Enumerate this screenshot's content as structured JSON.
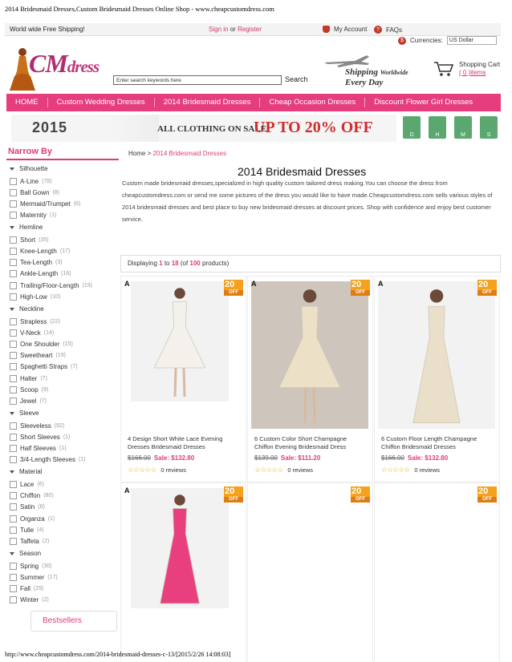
{
  "print_header": "2014 Bridesmaid Dresses,Custom Bridesmaid Dresses Online Shop - www.cheapcustomdress.com",
  "print_footer": "http://www.cheapcustomdress.com/2014-bridesmaid-dresses-c-13/[2015/2/26 14:08:03]",
  "topbar": {
    "free_shipping": "World wide Free Shipping!",
    "sign_in": "Sign in",
    "or": "or",
    "register": "Register",
    "my_account": "My Account",
    "faqs": "FAQs"
  },
  "currency": {
    "label": "Currencies:",
    "selected": "US Dollar"
  },
  "logo": {
    "main": "CM",
    "tail": "dress"
  },
  "search": {
    "placeholder": "Enter search keywords here",
    "button": "Search"
  },
  "shipping_badge": {
    "line1": "Shipping",
    "line1b": "Worldwide",
    "line2": "Every Day"
  },
  "cart": {
    "label": "Shopping Cart",
    "items": "( 0 )items"
  },
  "nav": [
    "HOME",
    "Custom Wedding Dresses",
    "2014 Bridesmaid Dresses",
    "Cheap Occasion Dresses",
    "Discount Flower Girl Dresses"
  ],
  "banner": {
    "year": "2015",
    "sale": "ALL CLOTHING ON SALE",
    "upto": "UP TO 20% OFF",
    "timer": [
      "D",
      "H",
      "M",
      "S"
    ]
  },
  "sidebar": {
    "title": "Narrow By",
    "groups": [
      {
        "name": "Silhouette",
        "options": [
          [
            "A-Line",
            "(78)"
          ],
          [
            "Ball Gown",
            "(8)"
          ],
          [
            "Mermaid/Trumpet",
            "(6)"
          ],
          [
            "Maternity",
            "(1)"
          ]
        ]
      },
      {
        "name": "Hemline",
        "options": [
          [
            "Short",
            "(35)"
          ],
          [
            "Knee-Length",
            "(17)"
          ],
          [
            "Tea-Length",
            "(3)"
          ],
          [
            "Ankle-Length",
            "(16)"
          ],
          [
            "Trailing/Floor-Length",
            "(19)"
          ],
          [
            "High-Low",
            "(10)"
          ]
        ]
      },
      {
        "name": "Neckline",
        "options": [
          [
            "Strapless",
            "(22)"
          ],
          [
            "V-Neck",
            "(14)"
          ],
          [
            "One Shoulder",
            "(15)"
          ],
          [
            "Sweetheart",
            "(19)"
          ],
          [
            "Spaghetti Straps",
            "(7)"
          ],
          [
            "Halter",
            "(7)"
          ],
          [
            "Scoop",
            "(9)"
          ],
          [
            "Jewel",
            "(7)"
          ]
        ]
      },
      {
        "name": "Sleeve",
        "options": [
          [
            "Sleeveless",
            "(92)"
          ],
          [
            "Short Sleeves",
            "(1)"
          ],
          [
            "Half Sleeves",
            "(1)"
          ],
          [
            "3/4-Length Sleeves",
            "(1)"
          ]
        ]
      },
      {
        "name": "Material",
        "options": [
          [
            "Lace",
            "(6)"
          ],
          [
            "Chiffon",
            "(80)"
          ],
          [
            "Satin",
            "(6)"
          ],
          [
            "Organza",
            "(1)"
          ],
          [
            "Tulle",
            "(4)"
          ],
          [
            "Taffeta",
            "(2)"
          ]
        ]
      },
      {
        "name": "Season",
        "options": [
          [
            "Spring",
            "(30)"
          ],
          [
            "Summer",
            "(17)"
          ],
          [
            "Fall",
            "(29)"
          ],
          [
            "Winter",
            "(2)"
          ]
        ]
      }
    ],
    "bestsellers": "Bestsellers"
  },
  "breadcrumb": {
    "home": "Home",
    "sep": ">",
    "current": "2014 Bridesmaid Dresses"
  },
  "page_title": "2014 Bridesmaid Dresses",
  "description": "Custom made bridesmaid dresses,specialized in high quality custom tailored dress making.You can choose the dress from cheapcustomdress.com or send me some pictures of the dress you would like to have made.Cheapcustomdress.com sells various styles of 2014 bridesmaid dresses and best place to buy new bridesmaid dresses at discount prices. Shop with confidence and enjoy best customer service.",
  "displaying": {
    "pre": "Displaying ",
    "from": "1",
    "to_word": " to ",
    "to": "18",
    "of_word": " (of ",
    "total": "100",
    "post": " products)"
  },
  "products": [
    {
      "name": "4 Design Short White Lace Evening Dresses Bridesmaid Dresses",
      "old": "$166.00",
      "sale": "Sale: $132.80",
      "reviews": "0 reviews",
      "badge": "A",
      "pct": "20",
      "off": "OFF",
      "dress_color": "#f4f1ec"
    },
    {
      "name": "6 Custom Color Short Champagne Chiffon Evening Bridesmaid Dress",
      "old": "$139.00",
      "sale": "Sale: $111.20",
      "reviews": "0 reviews",
      "badge": "A",
      "pct": "20",
      "off": "OFF",
      "dress_color": "#ece1c6"
    },
    {
      "name": "6 Custom Floor Length Champagne Chiffon Bridesmaid Dresses",
      "old": "$166.00",
      "sale": "Sale: $132.80",
      "reviews": "0 reviews",
      "badge": "A",
      "pct": "20",
      "off": "OFF",
      "dress_color": "#eadfc8"
    },
    {
      "badge": "A",
      "pct": "20",
      "off": "OFF",
      "dress_color": "#e8407e"
    },
    {
      "pct": "20",
      "off": "OFF"
    },
    {
      "pct": "20",
      "off": "OFF"
    }
  ],
  "colors": {
    "accent": "#e53d7d",
    "sale": "#e03a7c",
    "badge": "#f5a11d"
  },
  "stars": "☆☆☆☆☆"
}
